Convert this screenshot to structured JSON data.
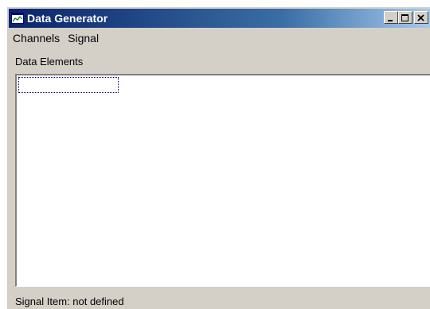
{
  "window": {
    "title": "Data Generator",
    "title_bar_colors": {
      "start": "#0a246a",
      "end": "#a6caf0"
    }
  },
  "menu": {
    "items": [
      {
        "label": "Channels"
      },
      {
        "label": "Signal"
      }
    ]
  },
  "data_elements": {
    "label": "Data Elements",
    "items": []
  },
  "status": {
    "text": "Signal Item: not defined"
  },
  "icons": {
    "app": "chart-window-icon",
    "minimize": "minimize-icon",
    "maximize": "maximize-icon",
    "close": "close-icon"
  }
}
